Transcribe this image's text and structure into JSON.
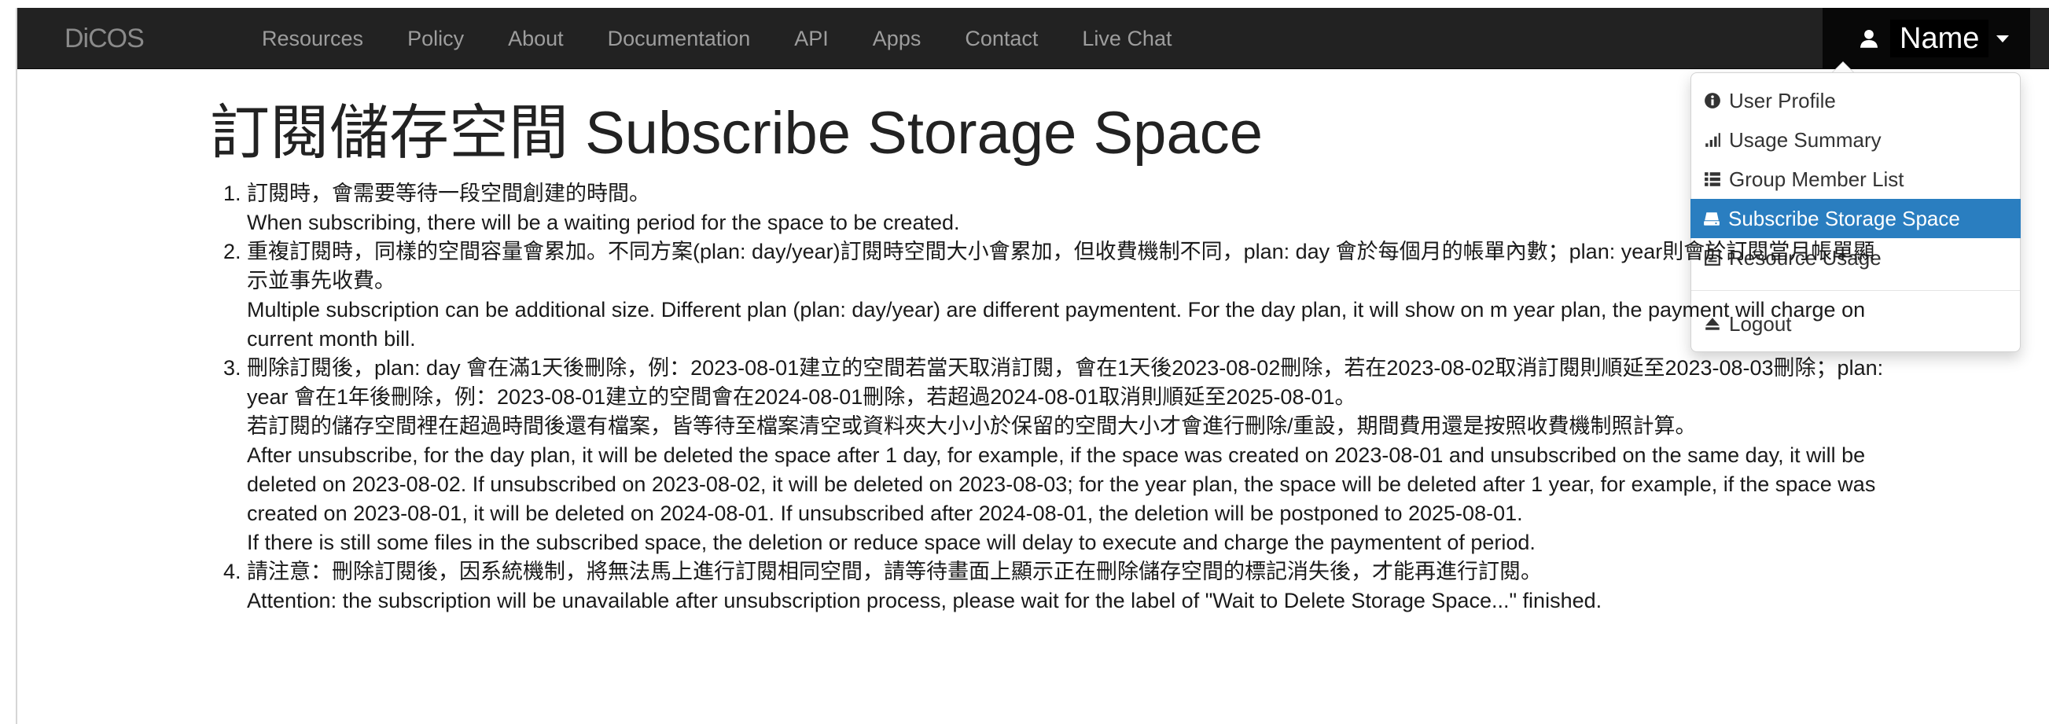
{
  "navbar": {
    "brand": "DiCOS",
    "items": [
      "Resources",
      "Policy",
      "About",
      "Documentation",
      "API",
      "Apps",
      "Contact",
      "Live Chat"
    ],
    "user_name": "Name"
  },
  "user_menu": {
    "items": [
      {
        "label": "User Profile",
        "icon": "info-circle-icon"
      },
      {
        "label": "Usage Summary",
        "icon": "signal-bars-icon"
      },
      {
        "label": "Group Member List",
        "icon": "list-icon"
      },
      {
        "label": "Subscribe Storage Space",
        "icon": "storage-drive-icon",
        "active": true
      },
      {
        "label": "Resource Usage",
        "icon": "ledger-icon"
      }
    ],
    "logout_label": "Logout"
  },
  "page": {
    "title": "訂閱儲存空間 Subscribe Storage Space",
    "notes": [
      [
        "訂閱時，會需要等待一段空間創建的時間。",
        "When subscribing, there will be a waiting period for the space to be created."
      ],
      [
        "重複訂閱時，同樣的空間容量會累加。不同方案(plan: day/year)訂閱時空間大小會累加，但收費機制不同，plan: day 會於每個月的帳單內數；plan: year則會於訂閱當月帳單顯示並事先收費。",
        "Multiple subscription can be additional size. Different plan (plan: day/year) are different paymentent. For the day plan, it will show on m year plan, the payment will charge on current month bill."
      ],
      [
        "刪除訂閱後，plan: day 會在滿1天後刪除，例：2023-08-01建立的空間若當天取消訂閱，會在1天後2023-08-02刪除，若在2023-08-02取消訂閱則順延至2023-08-03刪除；plan: year 會在1年後刪除，例：2023-08-01建立的空間會在2024-08-01刪除，若超過2024-08-01取消則順延至2025-08-01。",
        "若訂閱的儲存空間裡在超過時間後還有檔案，皆等待至檔案清空或資料夾大小小於保留的空間大小才會進行刪除/重設，期間費用還是按照收費機制照計算。",
        "After unsubscribe, for the day plan, it will be deleted the space after 1 day, for example, if the space was created on 2023-08-01 and unsubscribed on the same day, it will be deleted on 2023-08-02. If unsubscribed on 2023-08-02, it will be deleted on 2023-08-03; for the year plan, the space will be deleted after 1 year, for example, if the space was created on 2023-08-01, it will be deleted on 2024-08-01. If unsubscribed after 2024-08-01, the deletion will be postponed to 2025-08-01.",
        "If there is still some files in the subscribed space, the deletion or reduce space will delay to execute and charge the paymentent of period."
      ],
      [
        "請注意：刪除訂閱後，因系統機制，將無法馬上進行訂閱相同空間，請等待畫面上顯示正在刪除儲存空間的標記消失後，才能再進行訂閱。",
        "Attention: the subscription will be unavailable after unsubscription process, please wait for the label of \"Wait to Delete Storage Space...\" finished."
      ]
    ]
  },
  "colors": {
    "navbar_bg": "#222222",
    "nav_text": "#9d9d9d",
    "active_menu_bg": "#2a7ec0"
  }
}
